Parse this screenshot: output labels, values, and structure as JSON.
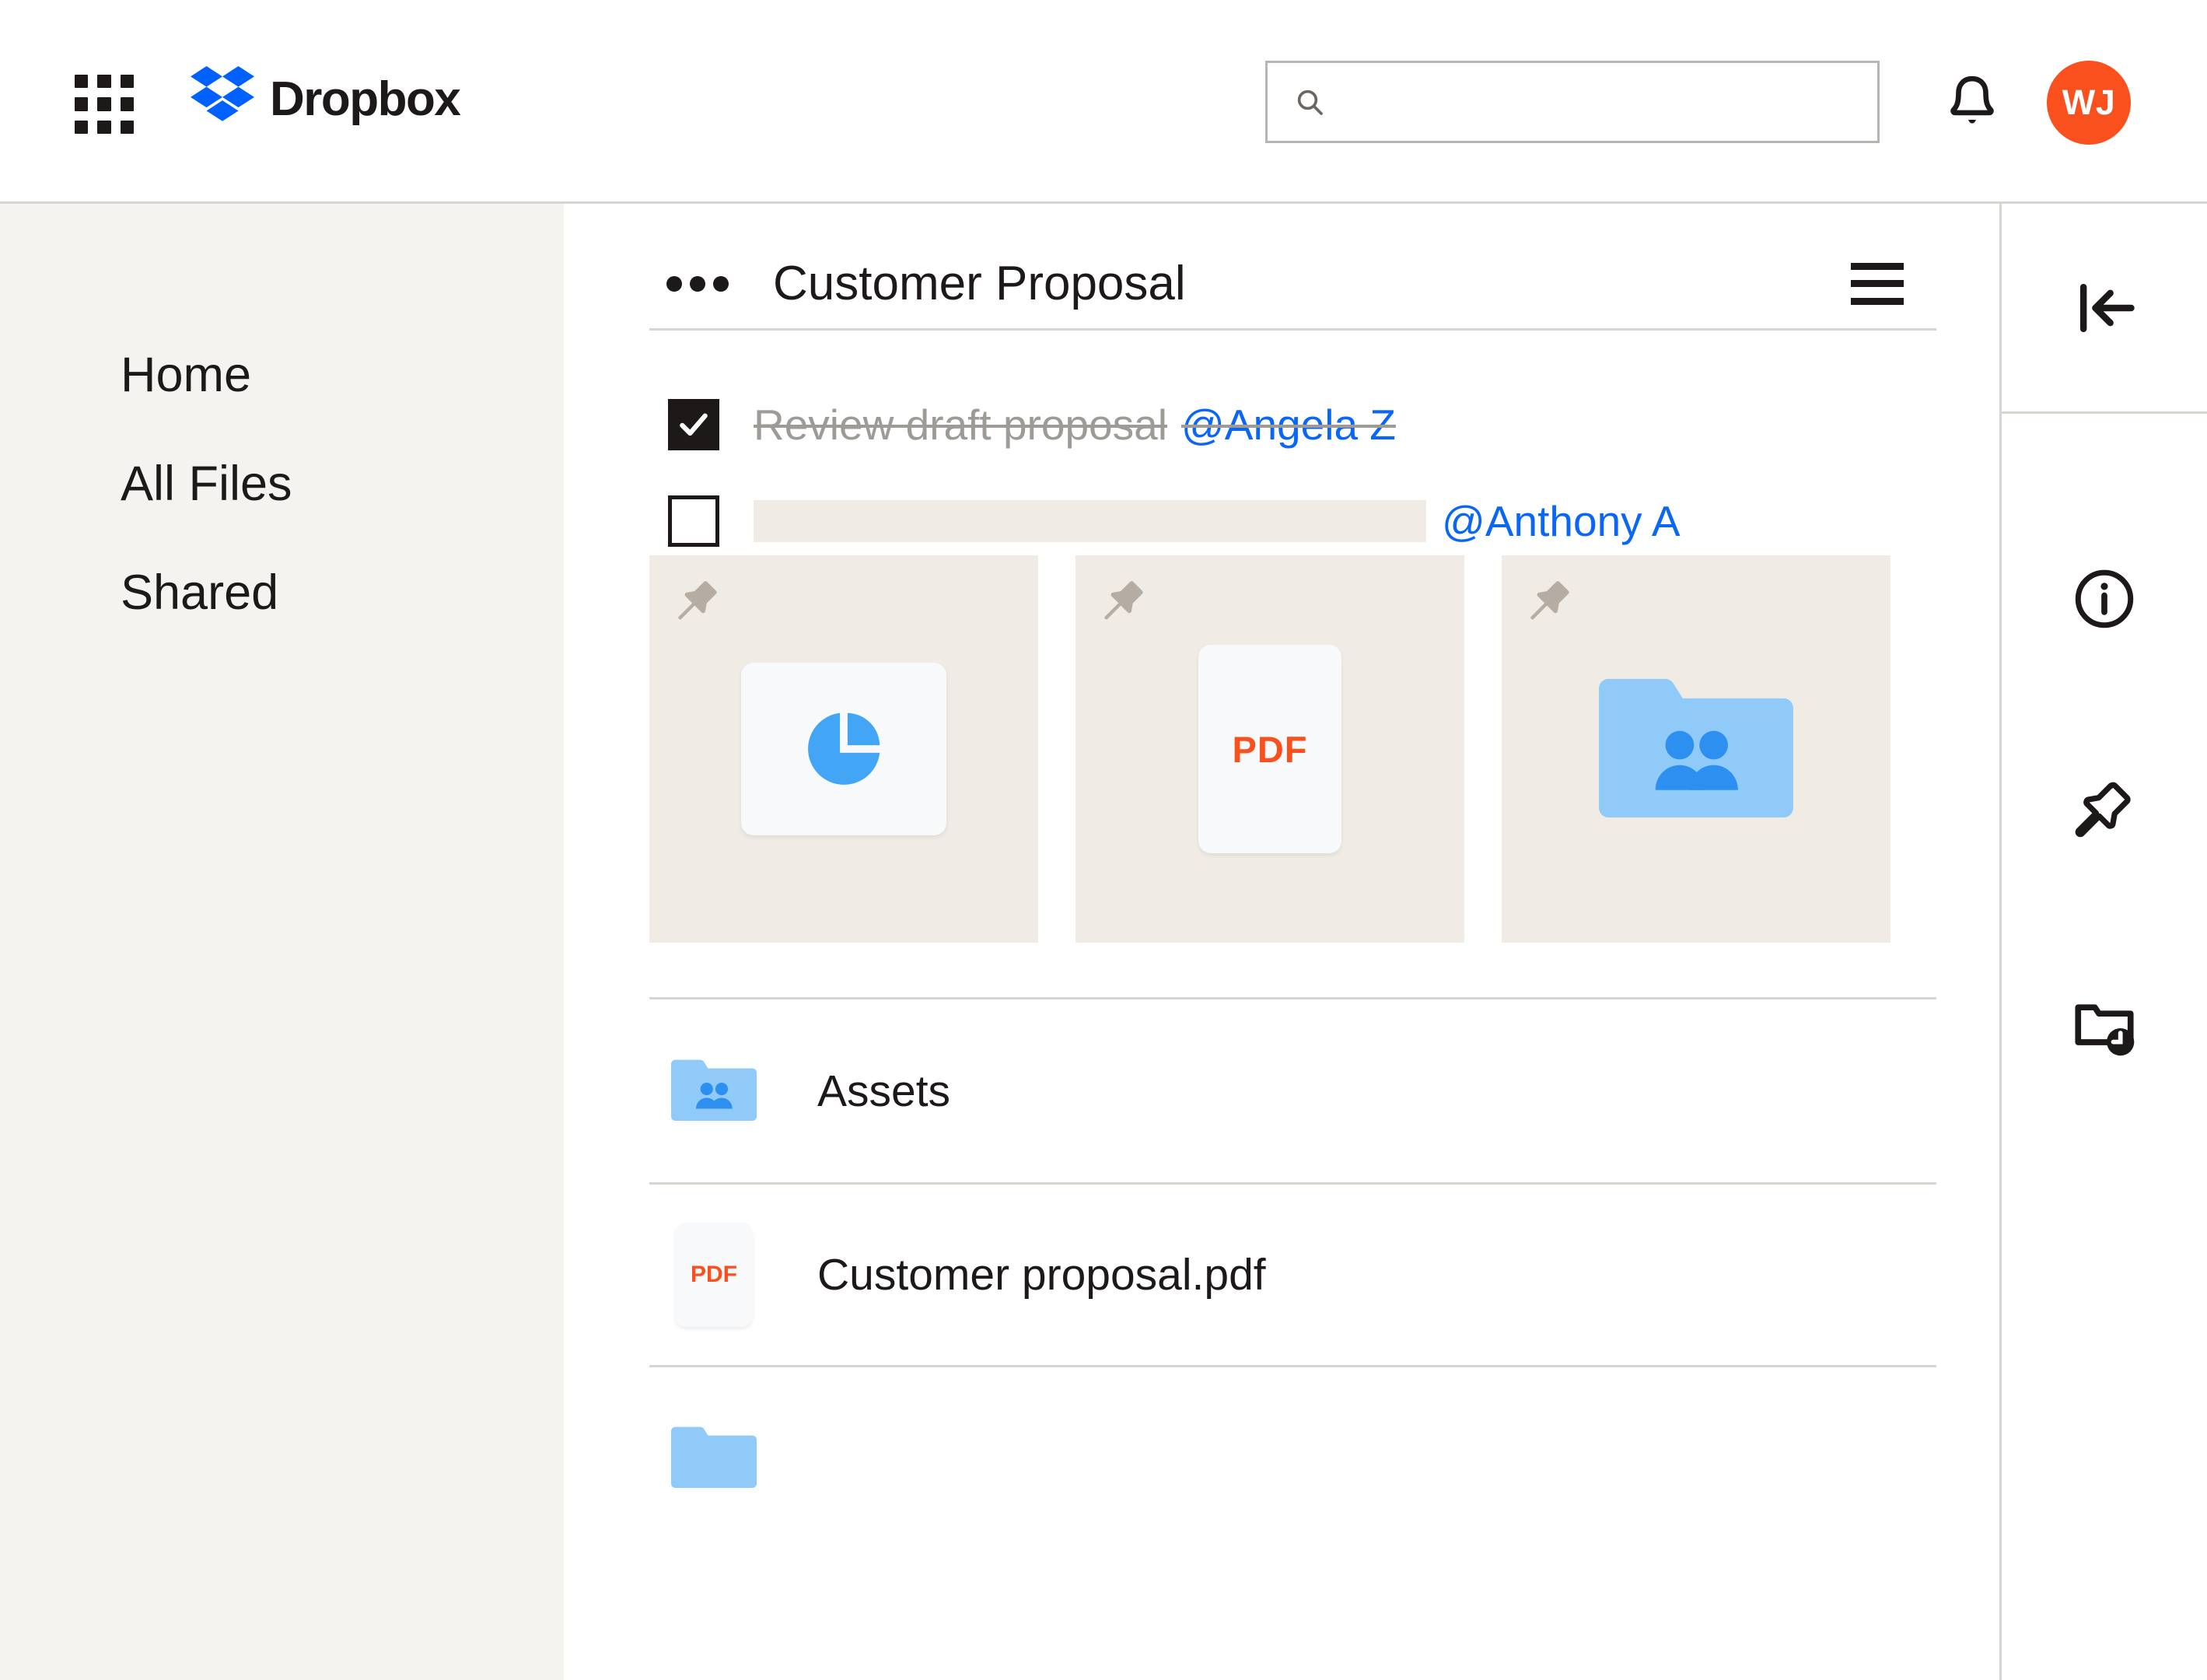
{
  "topbar": {
    "app_grid_icon": "apps-grid-icon",
    "brand_name": "Dropbox",
    "brand_logo_icon": "dropbox-logo-icon",
    "search": {
      "icon": "search-icon",
      "value": "",
      "placeholder": ""
    },
    "notifications_icon": "bell-icon",
    "avatar_initials": "WJ",
    "avatar_color": "#f9501e"
  },
  "sidebar": {
    "items": [
      {
        "label": "Home"
      },
      {
        "label": "All Files"
      },
      {
        "label": "Shared"
      }
    ]
  },
  "document": {
    "overflow_menu_icon": "ellipsis-icon",
    "title": "Customer Proposal",
    "menu_icon": "hamburger-menu-icon",
    "todos": [
      {
        "checked": true,
        "label": "Review draft proposal",
        "mention": "@Angela Z",
        "placeholder_bar": false
      },
      {
        "checked": false,
        "label": "",
        "mention": "@Anthony A",
        "placeholder_bar": true
      }
    ],
    "pinned": [
      {
        "name": "presentation-thumbnail",
        "icon": "pie-chart-icon",
        "pin_icon": "pin-icon",
        "label": ""
      },
      {
        "name": "pdf-thumbnail",
        "icon": "pdf-file-icon",
        "pin_icon": "pin-icon",
        "label": "PDF"
      },
      {
        "name": "shared-folder-thumbnail",
        "icon": "shared-folder-icon",
        "pin_icon": "pin-icon",
        "label": ""
      }
    ],
    "files": [
      {
        "name": "Assets",
        "icon": "shared-folder-icon",
        "type": "folder"
      },
      {
        "name": "Customer proposal.pdf",
        "icon": "pdf-file-icon",
        "type": "pdf",
        "badge_label": "PDF"
      },
      {
        "name": "",
        "icon": "folder-icon",
        "type": "folder"
      }
    ]
  },
  "right_rail": {
    "collapse_icon": "collapse-panel-icon",
    "items": [
      {
        "icon": "info-circle-icon"
      },
      {
        "icon": "pin-icon"
      },
      {
        "icon": "folder-clock-icon"
      }
    ]
  }
}
